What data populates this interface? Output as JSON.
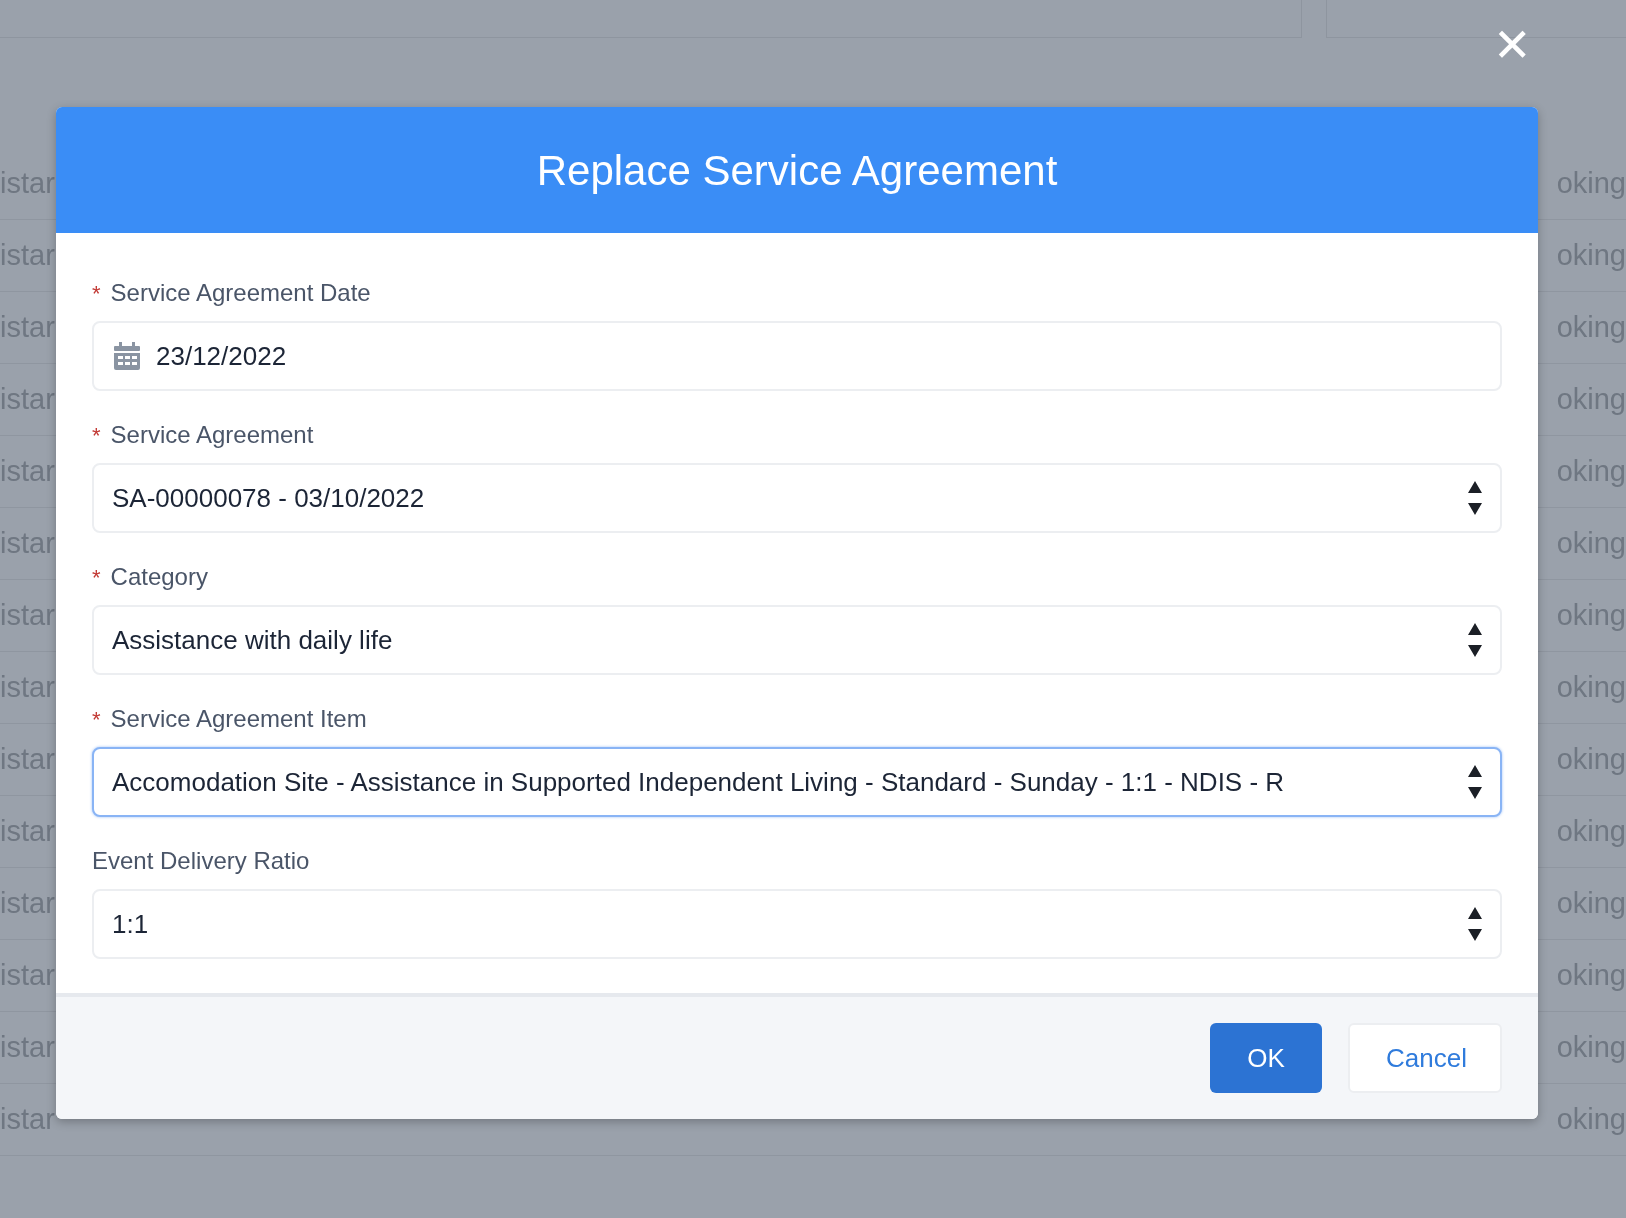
{
  "background_table": {
    "rows": [
      {
        "column_1": "istar",
        "column_2": "oking"
      },
      {
        "column_1": "istar",
        "column_2": "oking"
      },
      {
        "column_1": "istar",
        "column_2": "oking"
      },
      {
        "column_1": "istar",
        "column_2": "oking"
      },
      {
        "column_1": "istar",
        "column_2": "oking"
      },
      {
        "column_1": "istar",
        "column_2": "oking"
      },
      {
        "column_1": "istar",
        "column_2": "oking"
      },
      {
        "column_1": "istar",
        "column_2": "oking"
      },
      {
        "column_1": "istar",
        "column_2": "oking"
      },
      {
        "column_1": "istar",
        "column_2": "oking"
      },
      {
        "column_1": "istar",
        "column_2": "oking"
      },
      {
        "column_1": "istar",
        "column_2": "oking"
      },
      {
        "column_1": "istar",
        "column_2": "oking"
      },
      {
        "column_1": "istar",
        "column_2": "oking"
      }
    ]
  },
  "close": {
    "symbol": "✕"
  },
  "dialog": {
    "title": "Replace Service Agreement",
    "fields": [
      {
        "label": "Service Agreement Date",
        "required_marker": "*",
        "kind": "date",
        "value": "23/12/2022",
        "focused": false
      },
      {
        "label": "Service Agreement",
        "required_marker": "*",
        "kind": "select",
        "value": "SA-00000078 - 03/10/2022",
        "focused": false
      },
      {
        "label": "Category",
        "required_marker": "*",
        "kind": "select",
        "value": "Assistance with daily life",
        "focused": false
      },
      {
        "label": "Service Agreement Item",
        "required_marker": "*",
        "kind": "select",
        "value": "Accomodation Site - Assistance in Supported Independent Living - Standard - Sunday - 1:1 - NDIS - R",
        "focused": true
      },
      {
        "label": "Event Delivery Ratio",
        "kind": "select",
        "value": "1:1",
        "focused": false
      }
    ],
    "buttons": [
      {
        "label": "OK",
        "kind": "primary"
      },
      {
        "label": "Cancel",
        "kind": "secondary"
      }
    ]
  }
}
